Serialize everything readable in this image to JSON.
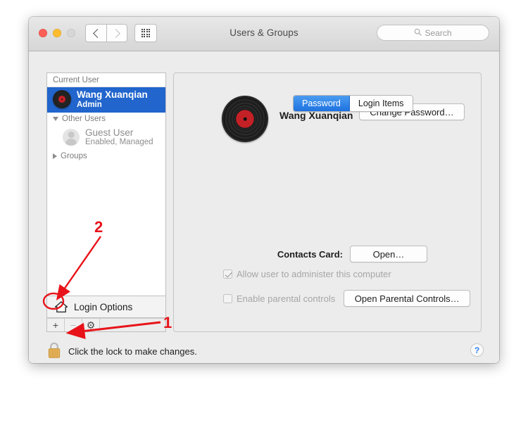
{
  "window": {
    "title": "Users & Groups",
    "traffic_lights": [
      "close-button",
      "minimize-button",
      "zoom-button"
    ],
    "nav": {
      "back": "back-button",
      "forward": "forward-button",
      "grid": "show-all-button"
    },
    "search": {
      "placeholder": "Search",
      "value": "",
      "icon": "search-icon"
    }
  },
  "sidebar": {
    "current_user_header": "Current User",
    "current_user": {
      "name": "Wang Xuanqian",
      "role": "Admin",
      "avatar": "vinyl-record-avatar",
      "selected": true
    },
    "other_users_header": "Other Users",
    "other_users": [
      {
        "name": "Guest User",
        "status": "Enabled, Managed",
        "avatar": "generic-person-avatar"
      }
    ],
    "groups_header": "Groups",
    "login_options_label": "Login Options",
    "login_options_icon": "home-icon",
    "toolbar": {
      "add_label": "+",
      "remove_label": "−",
      "gear_label": "⚙"
    }
  },
  "content": {
    "tabs": [
      {
        "label": "Password",
        "active": true
      },
      {
        "label": "Login Items",
        "active": false
      }
    ],
    "profile": {
      "name": "Wang Xuanqian",
      "avatar": "vinyl-record-avatar",
      "change_password_label": "Change Password…"
    },
    "contacts": {
      "label": "Contacts Card:",
      "open_label": "Open…"
    },
    "admin_checkbox": {
      "label": "Allow user to administer this computer",
      "checked": true,
      "enabled": false
    },
    "parental_checkbox": {
      "label": "Enable parental controls",
      "checked": false,
      "enabled": false
    },
    "parental_button_label": "Open Parental Controls…"
  },
  "footer": {
    "lock_icon": "padlock-locked-icon",
    "lock_text": "Click the lock to make changes.",
    "help_label": "?"
  },
  "annotations": [
    {
      "number": "1",
      "target": "lock-icon",
      "color": "#e8131a"
    },
    {
      "number": "2",
      "target": "add-user-button",
      "color": "#e8131a"
    }
  ],
  "colors": {
    "accent_blue": "#2165cd",
    "annotation_red": "#e8131a",
    "lock_gold": "#e8b45c",
    "help_blue": "#2d7ff0"
  }
}
